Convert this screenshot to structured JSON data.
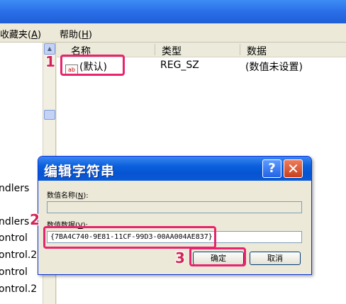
{
  "menu": {
    "favorites_label": "收藏夹(",
    "favorites_key": "A",
    "favorites_suffix": ")",
    "help_label": "帮助(",
    "help_key": "H",
    "help_suffix": ")"
  },
  "tree": {
    "items": [
      "ndlers",
      "ndlers",
      "ontrol",
      "ontrol.2",
      "ontrol",
      "ontrol.2"
    ]
  },
  "list": {
    "headers": {
      "name": "名称",
      "type": "类型",
      "data": "数据"
    },
    "row": {
      "icon": "ab-string-icon",
      "icon_text": "ab",
      "name": "(默认)",
      "type": "REG_SZ",
      "data": "(数值未设置)"
    }
  },
  "dialog": {
    "title": "编辑字符串",
    "help_symbol": "?",
    "close_symbol": "✕",
    "value_name_label": "数值名称(",
    "value_name_key": "N",
    "value_name_suffix": "):",
    "value_name": "",
    "value_data_label": "数值数据(",
    "value_data_key": "V",
    "value_data_suffix": "):",
    "value_data": "{7BA4C740-9E81-11CF-99D3-00AA004AE837}",
    "ok_label": "确定",
    "cancel_label": "取消"
  },
  "annotations": {
    "step1": "1",
    "step2": "2",
    "step3": "3"
  },
  "colors": {
    "highlight": "#e8246e",
    "titlebar": "#0a5fdc",
    "dialog_bg": "#ece9d8"
  }
}
